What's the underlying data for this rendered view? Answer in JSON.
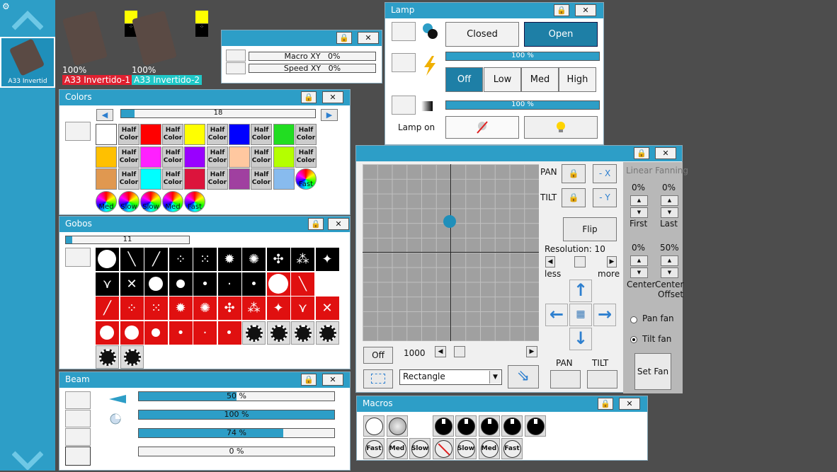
{
  "sidebar": {
    "fixture_label": "A33 Invertid"
  },
  "fixtures": [
    {
      "percent": "100%",
      "name": "A33 Invertido-1",
      "name_color": "#e02030"
    },
    {
      "percent": "100%",
      "name": "A33 Invertido-2",
      "name_color": "#20c8c8"
    }
  ],
  "macro_win": {
    "macro_label": "Macro XY",
    "macro_value": "0%",
    "speed_label": "Speed XY",
    "speed_value": "0%",
    "lock": "🔒",
    "close": "✕"
  },
  "lamp": {
    "title": "Lamp",
    "closed": "Closed",
    "open": "Open",
    "bar1": "100 %",
    "off": "Off",
    "low": "Low",
    "med": "Med",
    "high": "High",
    "bar2": "100 %",
    "lamp_on": "Lamp on",
    "lock": "🔒",
    "close": "✕"
  },
  "colors": {
    "title": "Colors",
    "slider_value": "18",
    "half": "Half",
    "color_word": "Color",
    "fast": "Fast",
    "med": "Med",
    "slow": "Slow",
    "lock": "🔒",
    "close": "✕"
  },
  "gobos": {
    "title": "Gobos",
    "slider_value": "11",
    "lock": "🔒",
    "close": "✕"
  },
  "beam": {
    "title": "Beam",
    "bars": [
      "50 %",
      "100 %",
      "74 %",
      "0 %"
    ],
    "bar_fills": [
      0.5,
      1.0,
      0.74,
      0.0
    ],
    "lock": "🔒",
    "close": "✕"
  },
  "pantilt": {
    "pan": "PAN",
    "tilt": "TILT",
    "minus_x": "- X",
    "minus_y": "- Y",
    "flip": "Flip",
    "resolution": "Resolution: 10",
    "less": "less",
    "more": "more",
    "off": "Off",
    "speed_value": "1000",
    "shape": "Rectangle",
    "pan_bottom": "PAN",
    "tilt_bottom": "TILT",
    "lock": "🔒",
    "close": "✕"
  },
  "fanning": {
    "title": "Linear Fanning",
    "first_val": "0%",
    "last_val": "0%",
    "first": "First",
    "last": "Last",
    "center_val": "0%",
    "offset_val": "50%",
    "center": "Center",
    "center_offset_1": "Center",
    "center_offset_2": "Offset",
    "pan_fan": "Pan fan",
    "tilt_fan": "Tilt fan",
    "set_fan": "Set Fan"
  },
  "macros": {
    "title": "Macros",
    "fast": "Fast",
    "med": "Med",
    "slow": "Slow",
    "lock": "🔒",
    "close": "✕"
  },
  "colors_palette": {
    "white": "#ffffff",
    "red": "#ff0000",
    "yellow": "#ffff00",
    "blue": "#0000ff",
    "green": "#22dd22",
    "orange": "#ffc000",
    "magenta": "#ff20ff",
    "purple": "#9900ff",
    "peach": "#ffc8a0",
    "lime": "#b4ff00",
    "amber": "#e09850",
    "cyan": "#00ffff",
    "crimson": "#dc143c",
    "violet": "#a040a0",
    "skyblue": "#88bbee",
    "accent": "#2d9ec7",
    "dark_accent": "#1e7fa6"
  }
}
